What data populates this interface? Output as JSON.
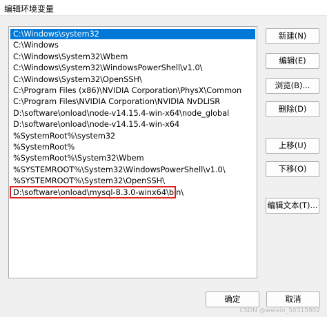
{
  "window": {
    "title": "编辑环境变量"
  },
  "paths": [
    "C:\\Windows\\system32",
    "C:\\Windows",
    "C:\\Windows\\System32\\Wbem",
    "C:\\Windows\\System32\\WindowsPowerShell\\v1.0\\",
    "C:\\Windows\\System32\\OpenSSH\\",
    "C:\\Program Files (x86)\\NVIDIA Corporation\\PhysX\\Common",
    "C:\\Program Files\\NVIDIA Corporation\\NVIDIA NvDLISR",
    "D:\\software\\onload\\node-v14.15.4-win-x64\\node_global",
    "D:\\software\\onload\\node-v14.15.4-win-x64",
    "%SystemRoot%\\system32",
    "%SystemRoot%",
    "%SystemRoot%\\System32\\Wbem",
    "%SYSTEMROOT%\\System32\\WindowsPowerShell\\v1.0\\",
    "%SYSTEMROOT%\\System32\\OpenSSH\\",
    "D:\\software\\onload\\mysql-8.3.0-winx64\\bin\\"
  ],
  "selected_index": 0,
  "highlighted_index": 14,
  "buttons": {
    "new": "新建(N)",
    "edit": "编辑(E)",
    "browse": "浏览(B)...",
    "delete": "删除(D)",
    "move_up": "上移(U)",
    "move_down": "下移(O)",
    "edit_text": "编辑文本(T)...",
    "ok": "确定",
    "cancel": "取消"
  },
  "watermark": "CSDN @weixin_50315902",
  "colors": {
    "selection": "#0078d7",
    "highlight_box": "#dd2222"
  }
}
